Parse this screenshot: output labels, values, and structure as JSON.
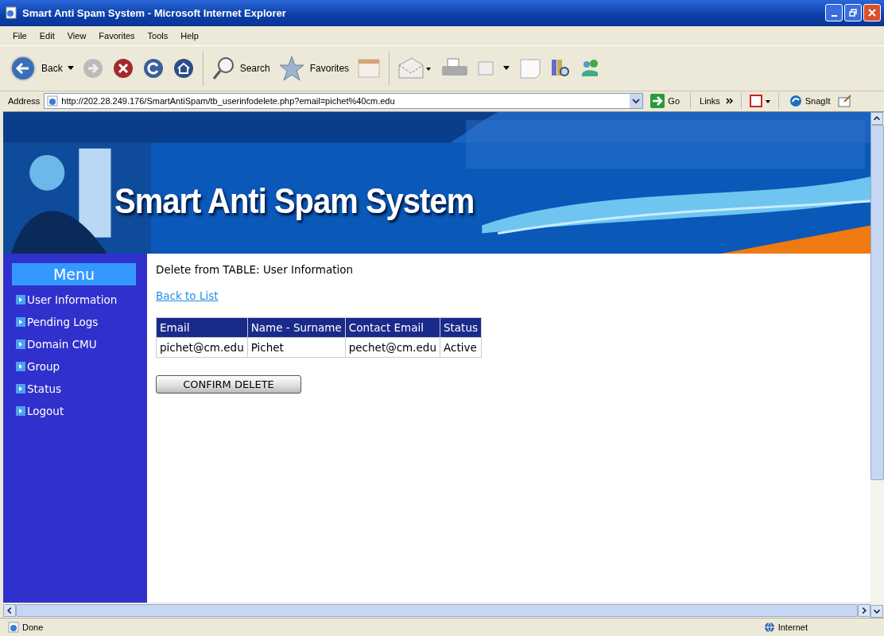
{
  "window": {
    "title": "Smart Anti Spam System - Microsoft Internet Explorer"
  },
  "menu_bar": [
    "File",
    "Edit",
    "View",
    "Favorites",
    "Tools",
    "Help"
  ],
  "toolbar": {
    "back": "Back",
    "search": "Search",
    "favorites": "Favorites"
  },
  "address_bar": {
    "label": "Address",
    "url": "http://202.28.249.176/SmartAntiSpam/tb_userinfodelete.php?email=pichet%40cm.edu",
    "go": "Go",
    "links": "Links",
    "snagit": "SnagIt"
  },
  "page": {
    "banner_title": "Smart Anti Spam System",
    "sidebar": {
      "heading": "Menu",
      "items": [
        "User Information",
        "Pending Logs",
        "Domain CMU",
        "Group",
        "Status",
        "Logout"
      ]
    },
    "heading": "Delete from TABLE: User Information",
    "back_link": "Back to List",
    "table": {
      "columns": [
        "Email",
        "Name - Surname",
        "Contact Email",
        "Status"
      ],
      "rows": [
        [
          "pichet@cm.edu",
          "Pichet",
          "pechet@cm.edu",
          "Active"
        ]
      ]
    },
    "confirm_button": "CONFIRM DELETE"
  },
  "status_bar": {
    "text": "Done",
    "zone": "Internet"
  }
}
